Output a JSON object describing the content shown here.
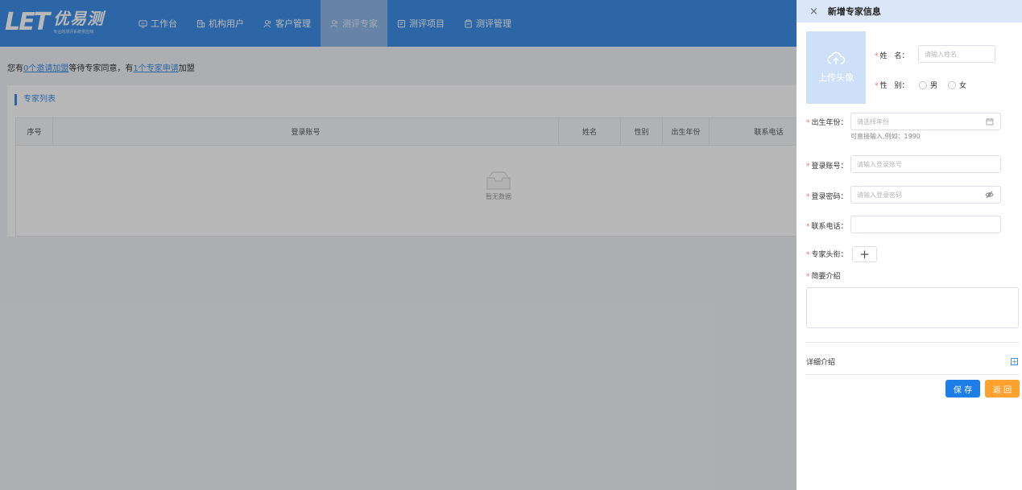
{
  "logo": {
    "mark": "LET",
    "name": "优易测",
    "slogan": "专业的测评系统供应商"
  },
  "nav": [
    {
      "label": "工作台",
      "icon": "monitor-icon"
    },
    {
      "label": "机构用户",
      "icon": "building-icon"
    },
    {
      "label": "客户管理",
      "icon": "users-icon"
    },
    {
      "label": "测评专家",
      "icon": "expert-icon",
      "active": true
    },
    {
      "label": "测评项目",
      "icon": "list-doc-icon"
    },
    {
      "label": "测评管理",
      "icon": "clipboard-icon"
    }
  ],
  "notice": {
    "prefix": "您有",
    "link1": "0个邀请加盟",
    "middle": "等待专家同意，有",
    "link2": "1个专家申请",
    "suffix": "加盟"
  },
  "panel": {
    "title": "专家列表",
    "columns": [
      "序号",
      "登录账号",
      "姓名",
      "性别",
      "出生年份",
      "联系电话"
    ],
    "empty_text": "暂无数据"
  },
  "drawer": {
    "close": "×",
    "title": "新增专家信息",
    "avatar_label": "上传头像",
    "name_label": "姓　名：",
    "name_placeholder": "请输入姓名",
    "gender_label": "性　别：",
    "gender_options": [
      "男",
      "女"
    ],
    "birth_label": "出生年份：",
    "birth_placeholder": "请选择年份",
    "birth_hint": "可直接输入,例如：1990",
    "account_label": "登录账号：",
    "account_placeholder": "请输入登录账号",
    "password_label": "登录密码：",
    "password_placeholder": "请输入登录密码",
    "phone_label": "联系电话：",
    "phone_value": "",
    "title_label": "专家头衔：",
    "add_symbol": "+",
    "intro_label": "简要介绍",
    "detail_label": "详细介绍",
    "expand_symbol": "+",
    "save_label": "保 存",
    "back_label": "返 回"
  },
  "colors": {
    "brand": "#3d8ee6",
    "required": "#f56c6c",
    "save": "#1e7de6",
    "back": "#ffa12e"
  }
}
